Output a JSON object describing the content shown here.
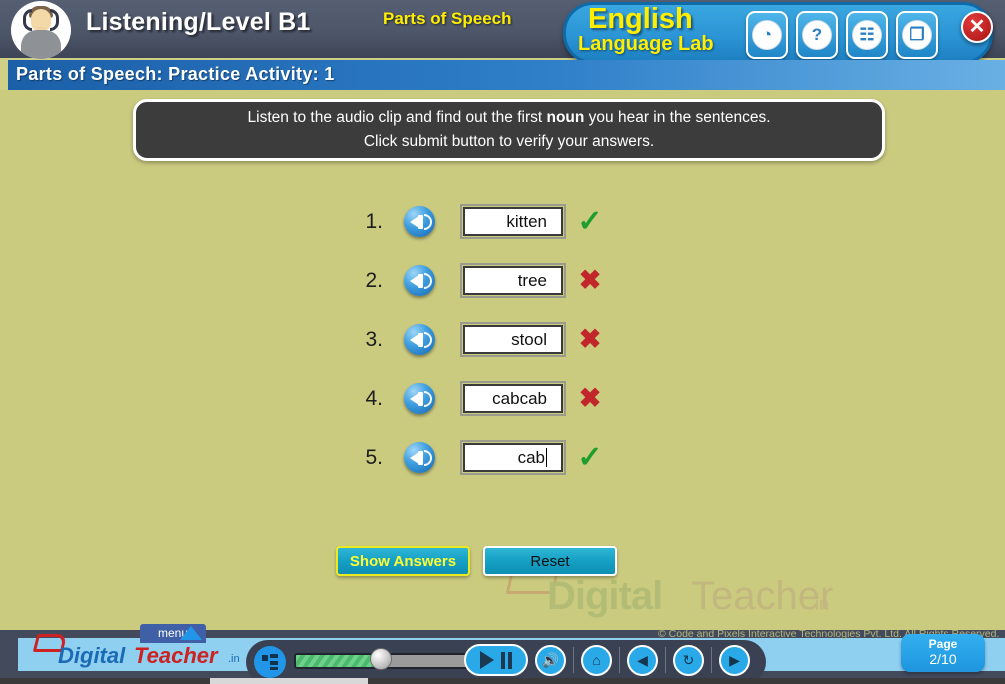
{
  "header": {
    "title": "Listening/Level B1",
    "topic": "Parts of Speech",
    "logo_line1": "English",
    "logo_line2": "Language Lab",
    "icons": [
      {
        "name": "history-folder-icon",
        "glyph": "◔"
      },
      {
        "name": "help-icon",
        "glyph": "?"
      },
      {
        "name": "glossary-book-icon",
        "glyph": "☷"
      },
      {
        "name": "restore-window-icon",
        "glyph": "❐"
      }
    ],
    "close_label": "✕",
    "avatar_name": "student-headphones-avatar"
  },
  "subtitle": "Parts of Speech: Practice Activity: 1",
  "instruction": {
    "line1_before": "Listen to the audio clip and find out the first ",
    "line1_bold": "noun",
    "line1_after": " you hear in the sentences.",
    "line2": "Click submit button to verify your answers."
  },
  "questions": [
    {
      "number": "1.",
      "value": "kitten",
      "result": "correct",
      "mark": "✓",
      "focused": false
    },
    {
      "number": "2.",
      "value": "tree",
      "result": "incorrect",
      "mark": "✖",
      "focused": false
    },
    {
      "number": "3.",
      "value": "stool",
      "result": "incorrect",
      "mark": "✖",
      "focused": false
    },
    {
      "number": "4.",
      "value": "cabcab",
      "result": "incorrect",
      "mark": "✖",
      "focused": false
    },
    {
      "number": "5.",
      "value": "cab",
      "result": "correct",
      "mark": "✓",
      "focused": true
    }
  ],
  "actions": {
    "show_answers": "Show Answers",
    "reset": "Reset"
  },
  "watermark": {
    "word1": "Digital",
    "word2": "Teacher",
    "suffix": ".in"
  },
  "footer": {
    "brand_word1": "Digital",
    "brand_word2": "Teacher",
    "brand_suffix": ".in",
    "menu_label": "menu",
    "copyright": "© Code and Pixels Interactive Technologies  Pvt. Ltd. All Rights Reserved.",
    "page_label": "Page",
    "page_value": "2/10",
    "progress_percent": 40,
    "controls": [
      {
        "name": "volume-button",
        "glyph": "🔊"
      },
      {
        "name": "home-button",
        "glyph": "⌂"
      },
      {
        "name": "previous-button",
        "glyph": "◀"
      },
      {
        "name": "refresh-button",
        "glyph": "↻"
      },
      {
        "name": "next-button",
        "glyph": "▶"
      }
    ]
  },
  "colors": {
    "stage_bg": "#cbcb80",
    "header_bg": "#4e566a",
    "accent_blue": "#2a93d4",
    "accent_yellow": "#ffee00",
    "correct_green": "#1f9e2f",
    "incorrect_red": "#c1262b"
  }
}
